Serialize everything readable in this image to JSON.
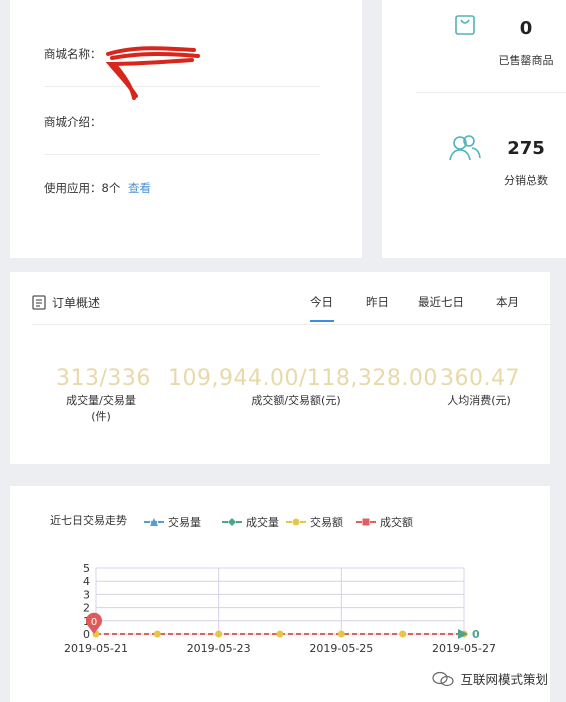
{
  "shop": {
    "name_label": "商城名称：",
    "intro_label": "商城介绍：",
    "apps_label": "使用应用：",
    "apps_count": "8个",
    "apps_link": "查看"
  },
  "stats": {
    "sold_out": {
      "value": "0",
      "label": "已售罄商品"
    },
    "distributors": {
      "value": "275",
      "label": "分销总数"
    }
  },
  "order": {
    "title": "订单概述",
    "tabs": [
      "今日",
      "昨日",
      "最近七日",
      "本月"
    ],
    "active_tab": "今日",
    "metrics": [
      {
        "value": "313/336",
        "label_line1": "成交量/交易量",
        "label_line2": "(件)"
      },
      {
        "value": "109,944.00/118,328.00",
        "label_line1": "成交额/交易额(元)",
        "label_line2": ""
      },
      {
        "value": "360.47",
        "label_line1": "人均消费(元)",
        "label_line2": ""
      }
    ]
  },
  "chart": {
    "title": "近七日交易走势",
    "legend": [
      {
        "name": "交易量",
        "color": "#5b9bd5",
        "marker": "triangle"
      },
      {
        "name": "成交量",
        "color": "#4aa58a",
        "marker": "diamond"
      },
      {
        "name": "交易额",
        "color": "#e8c547",
        "marker": "circle"
      },
      {
        "name": "成交额",
        "color": "#e06060",
        "marker": "square"
      }
    ],
    "end_label": "0",
    "start_badge": "0"
  },
  "chart_data": {
    "type": "line",
    "x": [
      "2019-05-21",
      "2019-05-22",
      "2019-05-23",
      "2019-05-24",
      "2019-05-25",
      "2019-05-26",
      "2019-05-27"
    ],
    "x_tick_labels": [
      "2019-05-21",
      "2019-05-23",
      "2019-05-25",
      "2019-05-27"
    ],
    "ylim": [
      0,
      5
    ],
    "y_ticks": [
      "0",
      "1",
      "2",
      "3",
      "4",
      "5"
    ],
    "grid": true,
    "legend_position": "top",
    "series": [
      {
        "name": "交易量",
        "values": [
          0,
          0,
          0,
          0,
          0,
          0,
          0
        ]
      },
      {
        "name": "成交量",
        "values": [
          0,
          0,
          0,
          0,
          0,
          0,
          0
        ]
      },
      {
        "name": "交易额",
        "values": [
          0,
          0,
          0,
          0,
          0,
          0,
          0
        ]
      },
      {
        "name": "成交额",
        "values": [
          0,
          0,
          0,
          0,
          0,
          0,
          0
        ]
      }
    ]
  },
  "watermark": {
    "text": "互联网模式策划"
  }
}
